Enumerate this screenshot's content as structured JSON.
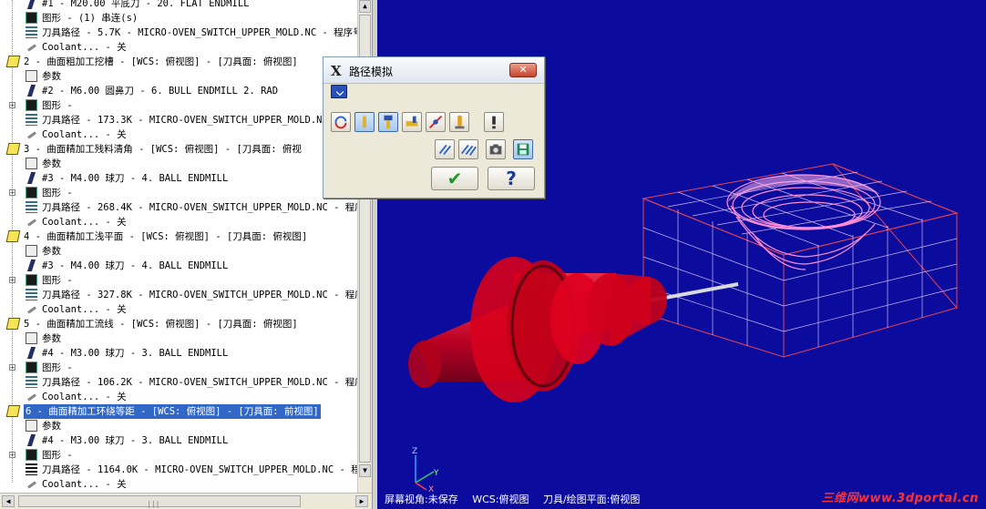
{
  "tree": {
    "rows": [
      {
        "indent": 1,
        "icon": "tool-icon",
        "text": "#1 - M20.00 平底刀 -     20. FLAT ENDMILL"
      },
      {
        "indent": 1,
        "icon": "geometry-icon",
        "text": "图形 - (1) 串连(s)"
      },
      {
        "indent": 1,
        "icon": "toolpath-icon",
        "text": "刀具路径 - 5.7K - MICRO-OVEN_SWITCH_UPPER_MOLD.NC - 程序号"
      },
      {
        "indent": 1,
        "icon": "coolant-icon",
        "text": "Coolant... - 关"
      },
      {
        "indent": 0,
        "icon": "folder-open-icon",
        "text": "2 - 曲面粗加工挖槽 - [WCS: 俯视图] - [刀具面: 俯视图]"
      },
      {
        "indent": 1,
        "icon": "params-icon",
        "text": "参数"
      },
      {
        "indent": 1,
        "icon": "tool-icon",
        "text": "#2 - M6.00 圆鼻刀 -     6. BULL ENDMILL 2. RAD"
      },
      {
        "indent": 1,
        "icon": "geometry-icon",
        "text": "图形 -",
        "plus": true
      },
      {
        "indent": 1,
        "icon": "toolpath-icon",
        "text": "刀具路径 - 173.3K - MICRO-OVEN_SWITCH_UPPER_MOLD.NC"
      },
      {
        "indent": 1,
        "icon": "coolant-icon",
        "text": "Coolant... - 关"
      },
      {
        "indent": 0,
        "icon": "folder-open-icon",
        "text": "3 - 曲面精加工残料清角 - [WCS: 俯视图] - [刀具面: 俯视"
      },
      {
        "indent": 1,
        "icon": "params-icon",
        "text": "参数"
      },
      {
        "indent": 1,
        "icon": "tool-icon",
        "text": "#3 - M4.00 球刀 -     4. BALL ENDMILL"
      },
      {
        "indent": 1,
        "icon": "geometry-icon",
        "text": "图形 -",
        "plus": true
      },
      {
        "indent": 1,
        "icon": "toolpath-icon",
        "text": "刀具路径 - 268.4K - MICRO-OVEN_SWITCH_UPPER_MOLD.NC - 程序"
      },
      {
        "indent": 1,
        "icon": "coolant-icon",
        "text": "Coolant... - 关"
      },
      {
        "indent": 0,
        "icon": "folder-open-icon",
        "text": "4 - 曲面精加工浅平面 - [WCS: 俯视图] - [刀具面: 俯视图]"
      },
      {
        "indent": 1,
        "icon": "params-icon",
        "text": "参数"
      },
      {
        "indent": 1,
        "icon": "tool-icon",
        "text": "#3 - M4.00 球刀 -     4. BALL ENDMILL"
      },
      {
        "indent": 1,
        "icon": "geometry-icon",
        "text": "图形 -",
        "plus": true
      },
      {
        "indent": 1,
        "icon": "toolpath-icon",
        "text": "刀具路径 - 327.8K - MICRO-OVEN_SWITCH_UPPER_MOLD.NC - 程序"
      },
      {
        "indent": 1,
        "icon": "coolant-icon",
        "text": "Coolant... - 关"
      },
      {
        "indent": 0,
        "icon": "folder-open-icon",
        "text": "5 - 曲面精加工流线 - [WCS: 俯视图] - [刀具面: 俯视图]"
      },
      {
        "indent": 1,
        "icon": "params-icon",
        "text": "参数"
      },
      {
        "indent": 1,
        "icon": "tool-icon",
        "text": "#4 - M3.00 球刀 -     3. BALL ENDMILL"
      },
      {
        "indent": 1,
        "icon": "geometry-icon",
        "text": "图形 -",
        "plus": true
      },
      {
        "indent": 1,
        "icon": "toolpath-icon",
        "text": "刀具路径 - 106.2K - MICRO-OVEN_SWITCH_UPPER_MOLD.NC - 程序"
      },
      {
        "indent": 1,
        "icon": "coolant-icon",
        "text": "Coolant... - 关"
      },
      {
        "indent": 0,
        "icon": "folder-open-icon",
        "text": "6 - 曲面精加工环绕等距 - [WCS: 俯视图] - [刀具面: 前视图]",
        "selected": true
      },
      {
        "indent": 1,
        "icon": "params-icon",
        "text": "参数"
      },
      {
        "indent": 1,
        "icon": "tool-icon",
        "text": "#4 - M3.00 球刀 -     3. BALL ENDMILL"
      },
      {
        "indent": 1,
        "icon": "geometry-icon",
        "text": "图形 -",
        "plus": true
      },
      {
        "indent": 1,
        "icon": "toolpath-bold-icon",
        "text": "刀具路径 - 1164.0K - MICRO-OVEN_SWITCH_UPPER_MOLD.NC - 程序"
      },
      {
        "indent": 1,
        "icon": "coolant-icon",
        "text": "Coolant... - 关"
      }
    ]
  },
  "dialog": {
    "title": "路径模拟",
    "close_label": "✕",
    "ok_label": "✔",
    "help_label": "?"
  },
  "viewport": {
    "status": {
      "screen_view": "屏幕视角:未保存",
      "wcs": "WCS:俯视图",
      "tool_plane": "刀具/绘图平面:俯视图"
    },
    "watermark": "三维网www.3dportal.cn",
    "axis_labels": {
      "x": "X",
      "y": "Y",
      "z": "Z"
    },
    "colors": {
      "background": "#0b0b9e",
      "holder": "#d8001c",
      "stock_wire": "#ff4040",
      "toolpath": "#ff8fd8"
    }
  }
}
